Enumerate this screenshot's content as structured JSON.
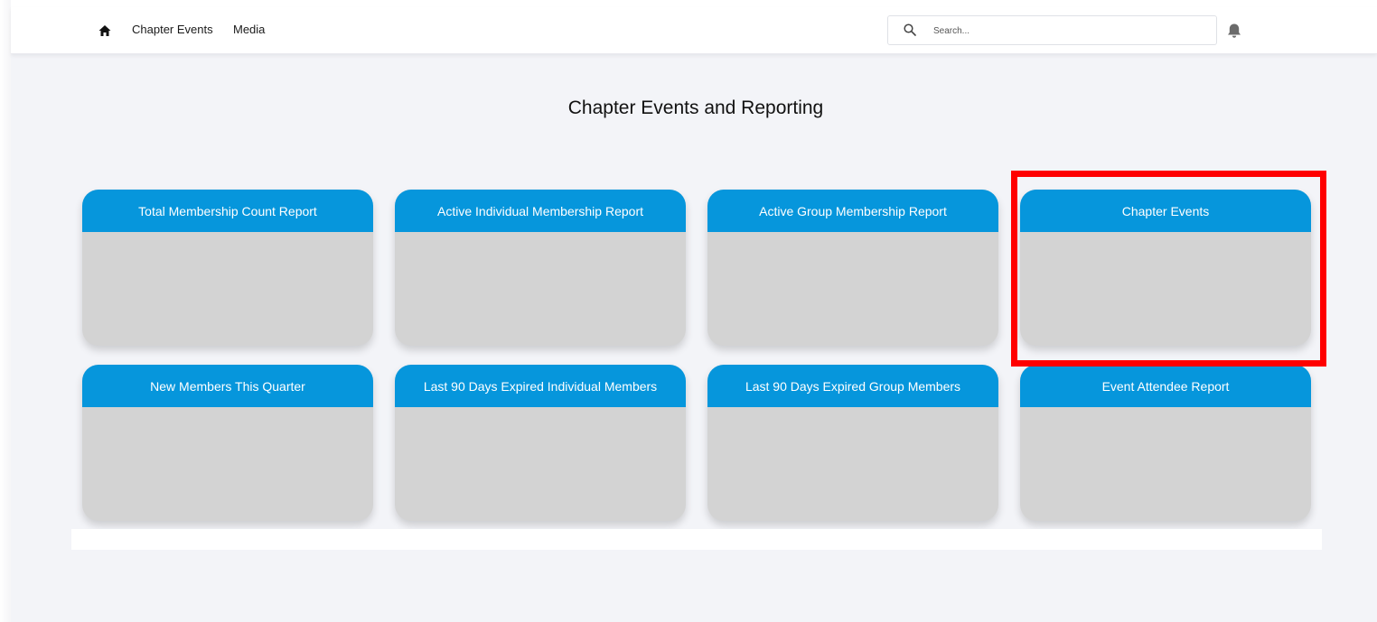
{
  "nav": {
    "home_icon": "home-icon",
    "links": [
      "Chapter Events",
      "Media"
    ],
    "search_placeholder": "Search...",
    "search_icon": "search-icon",
    "bell_icon": "bell-icon"
  },
  "page": {
    "title": "Chapter Events and Reporting"
  },
  "tiles": [
    {
      "title": "Total Membership Count Report"
    },
    {
      "title": "Active Individual Membership Report"
    },
    {
      "title": "Active Group Membership Report"
    },
    {
      "title": "Chapter Events"
    },
    {
      "title": "New Members This Quarter"
    },
    {
      "title": "Last 90 Days Expired Individual Members"
    },
    {
      "title": "Last 90 Days Expired Group Members"
    },
    {
      "title": "Event Attendee Report"
    }
  ],
  "colors": {
    "tile_header": "#0696dc",
    "tile_body": "#d3d3d3",
    "highlight": "#ff0000",
    "background": "#f3f4f8"
  }
}
